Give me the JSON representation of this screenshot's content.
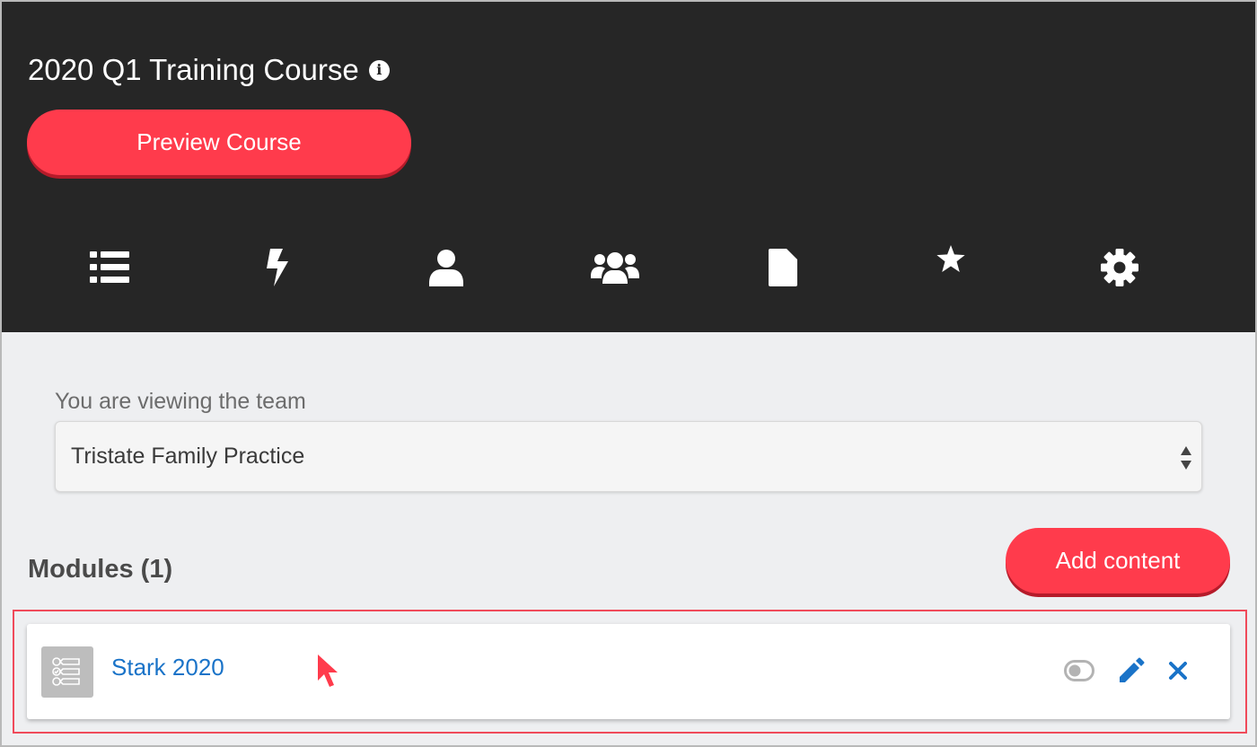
{
  "header": {
    "course_title": "2020 Q1 Training Course",
    "info_icon": "info-circle-icon",
    "preview_label": "Preview Course",
    "background": "#262626"
  },
  "tabs": [
    {
      "icon": "list-icon"
    },
    {
      "icon": "bolt-icon"
    },
    {
      "icon": "user-icon"
    },
    {
      "icon": "users-icon"
    },
    {
      "icon": "file-icon"
    },
    {
      "icon": "star-icon"
    },
    {
      "icon": "gear-icon"
    }
  ],
  "team": {
    "label": "You are viewing the team",
    "selected": "Tristate Family Practice"
  },
  "modules": {
    "heading": "Modules (1)",
    "add_label": "Add content",
    "items": [
      {
        "name": "Stark 2020",
        "thumb_icon": "checklist-icon",
        "actions": [
          "toggle-icon",
          "edit-icon",
          "delete-icon"
        ]
      }
    ]
  },
  "colors": {
    "accent": "#ff3b4c",
    "link": "#1a73c8",
    "page_bg": "#eeeff1"
  }
}
